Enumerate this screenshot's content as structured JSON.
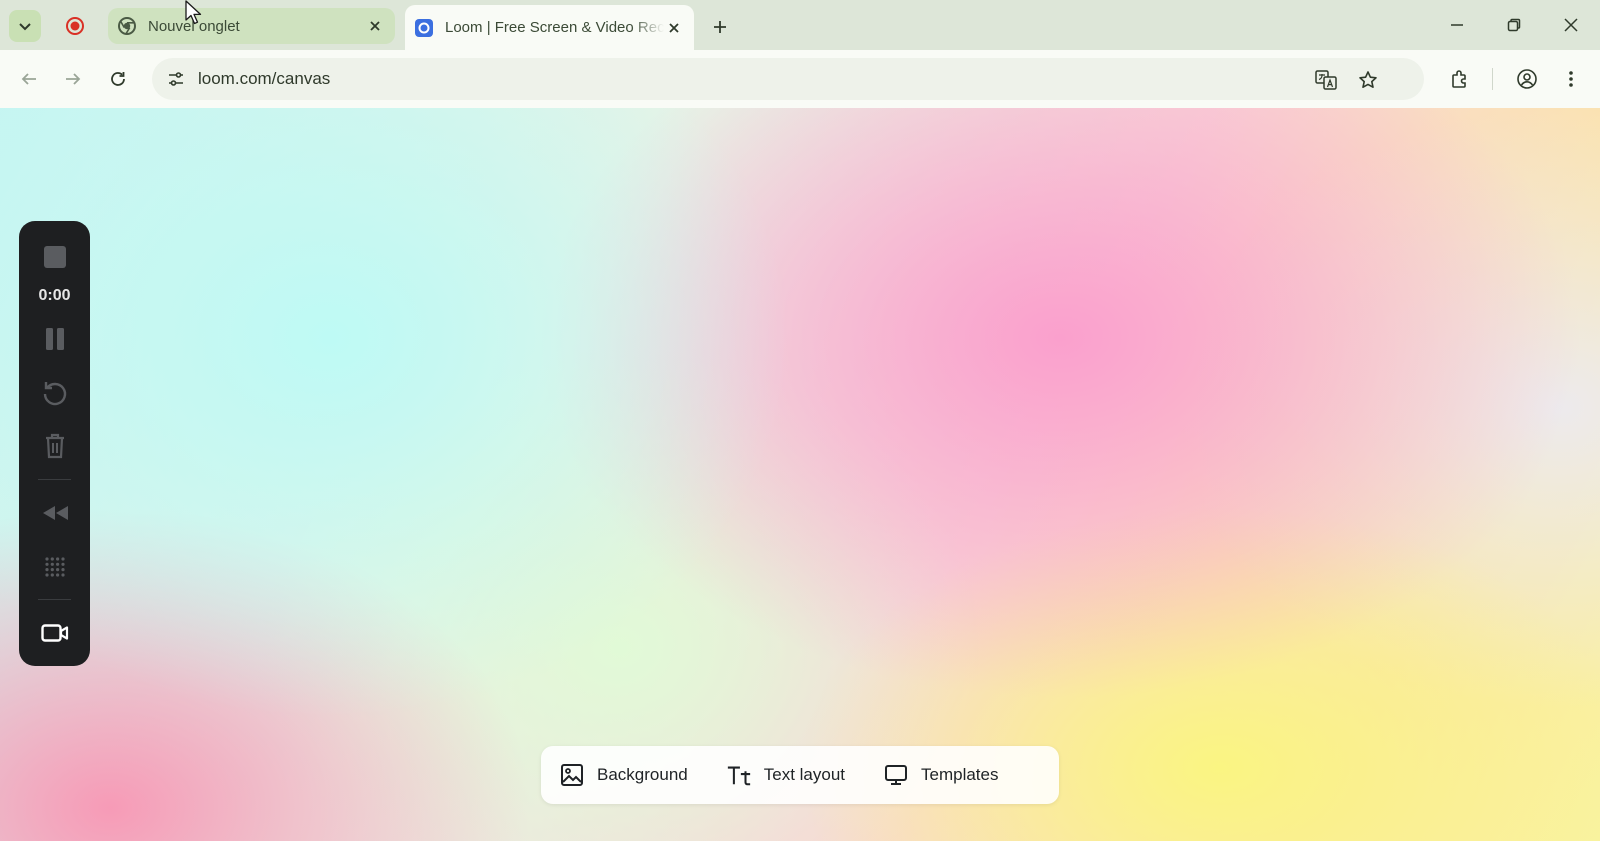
{
  "browser": {
    "tabs": [
      {
        "title": "Nouvel onglet",
        "favicon": "chrome-icon",
        "active": false
      },
      {
        "title": "Loom | Free Screen & Video Recording Software",
        "favicon": "loom-icon",
        "active": true
      }
    ],
    "address_bar": {
      "url": "loom.com/canvas"
    }
  },
  "recorder": {
    "timer": "0:00"
  },
  "bottom_bar": {
    "background_label": "Background",
    "text_layout_label": "Text layout",
    "templates_label": "Templates"
  },
  "colors": {
    "recording_red": "#d93025",
    "panel_dark": "#1e1f21",
    "tab_strip": "#dde6d8"
  }
}
